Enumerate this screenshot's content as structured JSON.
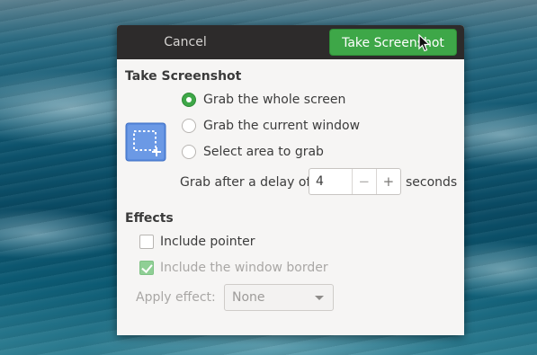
{
  "header": {
    "cancel_label": "Cancel",
    "take_label": "Take Screenshot"
  },
  "capture": {
    "section_title": "Take Screenshot",
    "options": [
      {
        "label": "Grab the whole screen",
        "selected": true
      },
      {
        "label": "Grab the current window",
        "selected": false
      },
      {
        "label": "Select area to grab",
        "selected": false
      }
    ],
    "delay_label": "Grab after a delay of",
    "delay_value": "4",
    "minus_glyph": "−",
    "plus_glyph": "+",
    "seconds_label": "seconds"
  },
  "effects": {
    "section_title": "Effects",
    "include_pointer_label": "Include pointer",
    "include_pointer_checked": false,
    "include_border_label": "Include the window border",
    "include_border_checked": true,
    "include_border_enabled": false,
    "apply_effect_label": "Apply effect:",
    "apply_effect_value": "None"
  },
  "colors": {
    "accent_green": "#3ea748",
    "headerbar": "#2d2b2b",
    "dialog_bg": "#f6f5f4",
    "icon_blue": "#5b8cde"
  },
  "icons": {
    "screenshot": "screen-selection-icon",
    "cursor": "mouse-pointer-icon"
  }
}
